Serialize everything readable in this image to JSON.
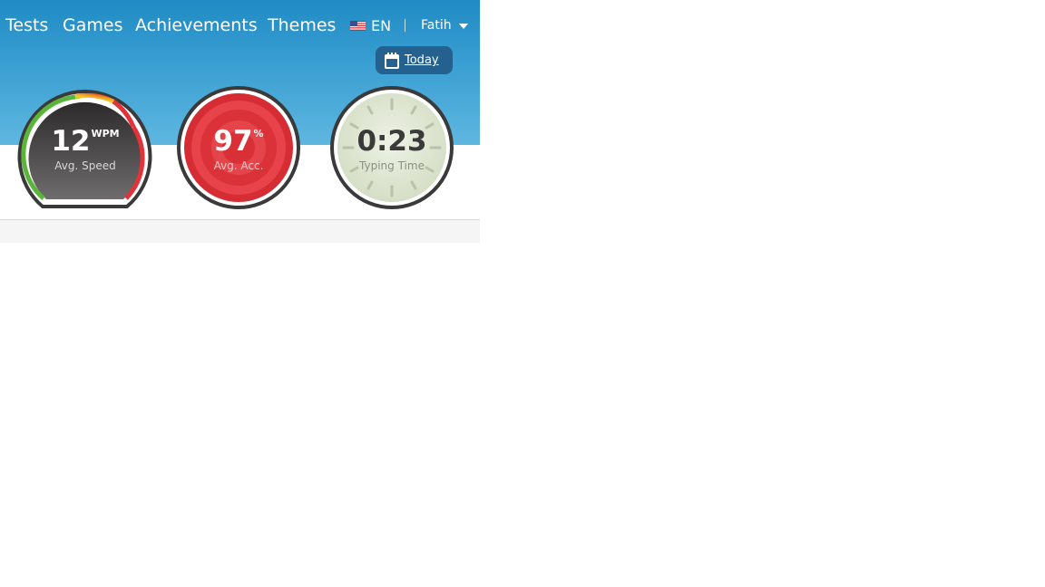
{
  "nav": {
    "items": [
      {
        "label": "Tests"
      },
      {
        "label": "Games"
      },
      {
        "label": "Achievements"
      },
      {
        "label": "Themes"
      }
    ],
    "language": {
      "code": "EN",
      "flag": "us-flag-icon"
    },
    "user": {
      "name": "Fatih"
    }
  },
  "date_filter": {
    "label": "Today",
    "icon": "calendar-icon"
  },
  "stats": {
    "speed": {
      "value": "12",
      "unit": "WPM",
      "label": "Avg. Speed"
    },
    "accuracy": {
      "value": "97",
      "unit": "%",
      "label": "Avg. Acc."
    },
    "time": {
      "value": "0:23",
      "label": "Typing Time"
    }
  },
  "colors": {
    "header_top": "#1f8bc4",
    "header_bottom": "#5fb7e0",
    "button_bg": "#25618e",
    "accuracy_red": "#e2333b",
    "clock_face": "#dde5cf",
    "dial_ring": "#3a3a3a"
  }
}
